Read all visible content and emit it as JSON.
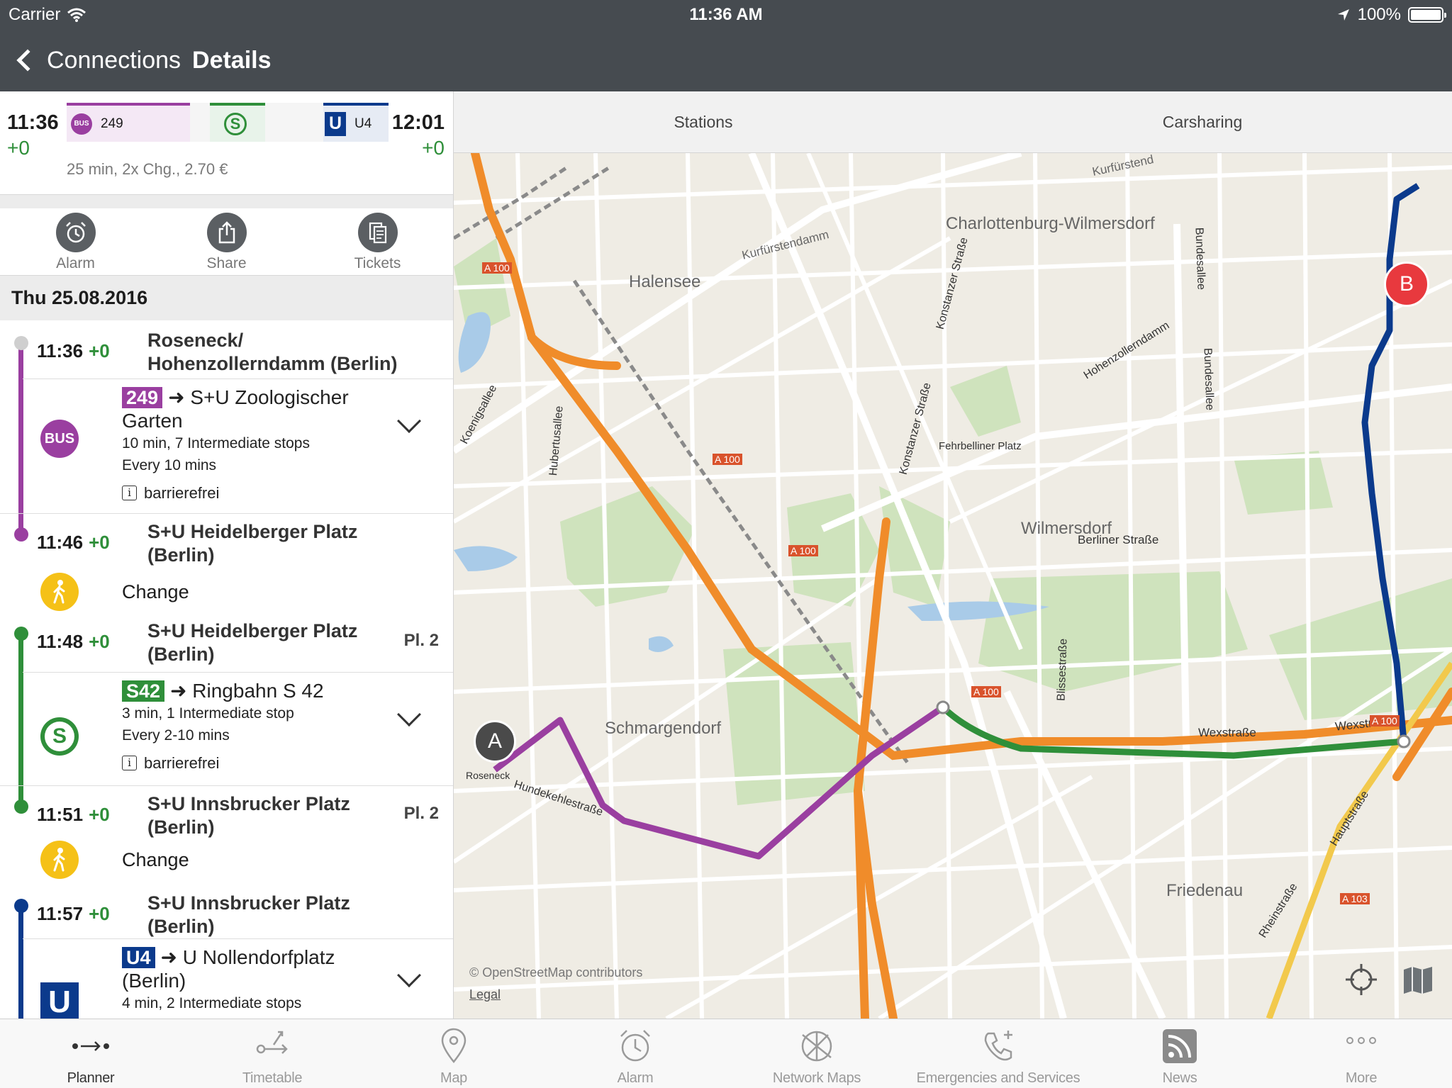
{
  "status": {
    "carrier": "Carrier",
    "time": "11:36 AM",
    "battery": "100%",
    "battery_level": 1.0
  },
  "nav": {
    "back_label": "Connections",
    "title": "Details"
  },
  "summary": {
    "dep_time": "11:36",
    "dep_delay": "+0",
    "arr_time": "12:01",
    "arr_delay": "+0",
    "bus_badge": "BUS",
    "bus_line": "249",
    "s_badge": "S",
    "u_badge": "U",
    "u_line": "U4",
    "info": "25 min, 2x Chg., 2.70 €"
  },
  "actions": [
    {
      "label": "Alarm",
      "icon": "alarm-clock-icon"
    },
    {
      "label": "Share",
      "icon": "share-icon"
    },
    {
      "label": "Tickets",
      "icon": "tickets-icon"
    }
  ],
  "date": "Thu 25.08.2016",
  "itinerary": {
    "stop1": {
      "time": "11:36",
      "delay": "+0",
      "name": "Roseneck/ Hohenzollerndamm (Berlin)"
    },
    "leg1": {
      "mode_icon": "BUS",
      "line": "249",
      "arrow": "➜",
      "direction": "S+U Zoologischer Garten",
      "duration": "10 min, 7 Intermediate stops",
      "frequency": "Every 10 mins",
      "accessibility": "barrierefrei",
      "color": "#9a3fa0"
    },
    "stop2": {
      "time": "11:46",
      "delay": "+0",
      "name": "S+U Heidelberger Platz (Berlin)"
    },
    "change1": "Change",
    "stop3": {
      "time": "11:48",
      "delay": "+0",
      "name": "S+U Heidelberger Platz (Berlin)",
      "platform": "Pl. 2"
    },
    "leg2": {
      "mode_icon": "S",
      "line": "S42",
      "arrow": "➜",
      "direction": "Ringbahn S 42",
      "duration": "3 min, 1 Intermediate stop",
      "frequency": "Every 2-10 mins",
      "accessibility": "barrierefrei",
      "color": "#2f8f3a"
    },
    "stop4": {
      "time": "11:51",
      "delay": "+0",
      "name": "S+U Innsbrucker Platz (Berlin)",
      "platform": "Pl. 2"
    },
    "change2": "Change",
    "stop5": {
      "time": "11:57",
      "delay": "+0",
      "name": "S+U Innsbrucker Platz (Berlin)"
    },
    "leg3": {
      "mode_icon": "U",
      "line": "U4",
      "arrow": "➜",
      "direction": "U Nollendorfplatz (Berlin)",
      "duration": "4 min, 2 Intermediate stops",
      "color": "#0b3a8c"
    }
  },
  "segments": [
    "Stations",
    "Carsharing"
  ],
  "map": {
    "labels": {
      "charlottenburg": "Charlottenburg-Wilmersdorf",
      "halensee": "Halensee",
      "kurfuerstendamm": "Kurfürstendamm",
      "kurfuerstendamm2": "Kurfürstend",
      "wilmersdorf": "Wilmersdorf",
      "berliner": "Berliner Straße",
      "fehrbelliner": "Fehrbelliner Platz",
      "schmargendorf": "Schmargendorf",
      "friedenau": "Friedenau",
      "wexstrasse1": "Wexstraße",
      "wexstrasse2": "Wexstraß",
      "roseneck": "Roseneck",
      "hundekehle": "Hundekehlestraße",
      "hohenzollerndamm": "Hohenzollerndamm",
      "konstanzer": "Konstanzer Straße",
      "bundesallee": "Bundesallee",
      "hubertusallee": "Hubertusallee",
      "koenigsallee": "Koenigsallee",
      "blissestrasse": "Blissestraße",
      "hauptstrasse": "Hauptstraße",
      "rheinstrasse": "Rheinstraße",
      "a100": "A 100",
      "a103": "A 103"
    },
    "copyright": "© OpenStreetMap contributors",
    "legal": "Legal",
    "pin_a": "A",
    "pin_b": "B",
    "route_colors": {
      "bus": "#9a3fa0",
      "s": "#2f8f3a",
      "u": "#0b3a8c"
    }
  },
  "tabs": [
    {
      "label": "Planner",
      "icon": "planner-icon",
      "active": true
    },
    {
      "label": "Timetable",
      "icon": "timetable-icon",
      "active": false
    },
    {
      "label": "Map",
      "icon": "map-pin-icon",
      "active": false
    },
    {
      "label": "Alarm",
      "icon": "alarm-clock-icon",
      "active": false
    },
    {
      "label": "Network Maps",
      "icon": "network-maps-icon",
      "active": false
    },
    {
      "label": "Emergencies and Services",
      "icon": "phone-icon",
      "active": false
    },
    {
      "label": "News",
      "icon": "rss-icon",
      "active": false
    },
    {
      "label": "More",
      "icon": "more-icon",
      "active": false
    }
  ]
}
